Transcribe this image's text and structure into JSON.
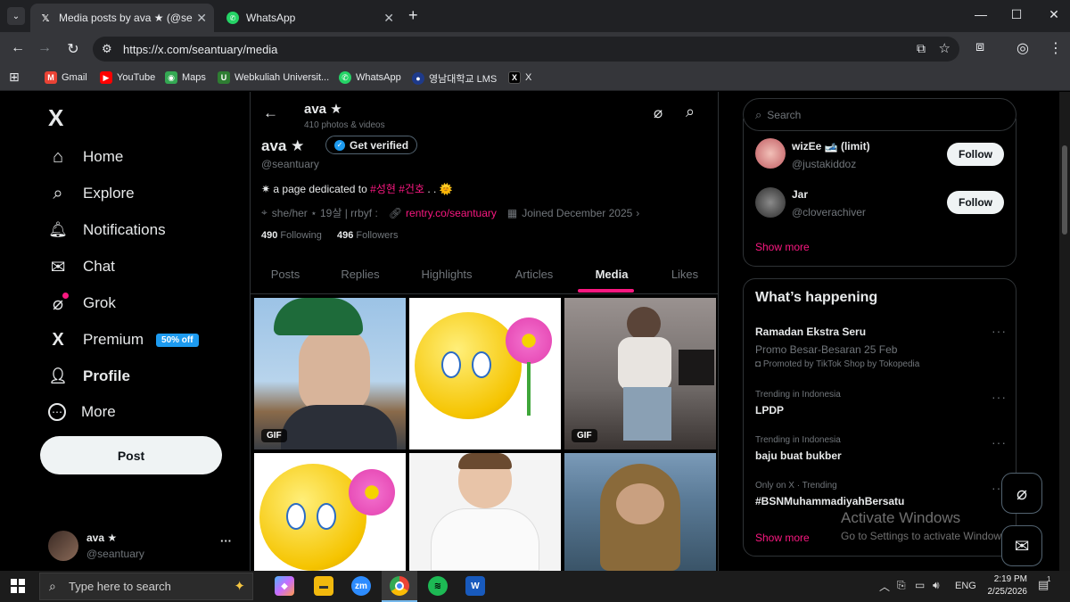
{
  "browser": {
    "tabs": [
      {
        "title": "Media posts by ava ★ (@seantu",
        "icon": "x-logo-icon"
      },
      {
        "title": "WhatsApp",
        "icon": "whatsapp-icon"
      }
    ],
    "new_tab": "+",
    "url": "https://x.com/seantuary/media",
    "bookmarks": [
      {
        "label": "Gmail",
        "color": "#ea4335",
        "glyph": "M"
      },
      {
        "label": "YouTube",
        "color": "#ff0000",
        "glyph": "▶"
      },
      {
        "label": "Maps",
        "color": "#34a853",
        "glyph": "◉"
      },
      {
        "label": "Webkuliah Universit...",
        "color": "#2e7d32",
        "glyph": "U"
      },
      {
        "label": "WhatsApp",
        "color": "#25d366",
        "glyph": "✆"
      },
      {
        "label": "영남대학교 LMS",
        "color": "#1e3a8a",
        "glyph": "●"
      },
      {
        "label": "X",
        "color": "#000000",
        "glyph": "X"
      }
    ]
  },
  "sidebar": {
    "logo": "X",
    "items": [
      {
        "label": "Home",
        "icon": "home-icon",
        "glyph": "⌂"
      },
      {
        "label": "Explore",
        "icon": "search-icon",
        "glyph": "⌕"
      },
      {
        "label": "Notifications",
        "icon": "bell-icon",
        "glyph": "🔔"
      },
      {
        "label": "Chat",
        "icon": "mail-icon",
        "glyph": "✉"
      },
      {
        "label": "Grok",
        "icon": "grok-icon",
        "glyph": "⌀"
      },
      {
        "label": "Premium",
        "icon": "x-logo-icon",
        "glyph": "X",
        "badge": "50% off"
      },
      {
        "label": "Profile",
        "icon": "person-icon",
        "glyph": "👤"
      },
      {
        "label": "More",
        "icon": "more-circle-icon",
        "glyph": "⋯"
      }
    ],
    "post_label": "Post",
    "account": {
      "name": "ava ★",
      "handle": "@seantuary",
      "more": "···"
    }
  },
  "profile": {
    "header_name": "ava ★",
    "header_count": "410 photos & videos",
    "name": "ava ★",
    "verify_label": "Get verified",
    "handle": "@seantuary",
    "bio_prefix": "✷ a page dedicated to ",
    "bio_tags": "#성현 #건호",
    "bio_suffix": " . . 🌞",
    "location": "she/her ⋆ 19살 | rrbyf :",
    "link": "rentry.co/seantuary",
    "joined": "Joined December 2025",
    "following_count": "490",
    "following_label": "Following",
    "followers_count": "496",
    "followers_label": "Followers",
    "tabs": [
      "Posts",
      "Replies",
      "Highlights",
      "Articles",
      "Media",
      "Likes"
    ],
    "active_tab": "Media",
    "gif_label": "GIF"
  },
  "right": {
    "search_placeholder": "Search",
    "who_to_follow": [
      {
        "name": "wizEe 🎿 (limit)",
        "handle": "@justakiddoz",
        "button": "Follow"
      },
      {
        "name": "Jar",
        "handle": "@cloverachiver",
        "button": "Follow"
      }
    ],
    "show_more": "Show more",
    "happening_title": "What’s happening",
    "trends": [
      {
        "context": "",
        "name": "Ramadan Ekstra Seru",
        "sub": "Promo Besar-Besaran 25 Feb",
        "promoted": "Promoted by TikTok Shop by Tokopedia"
      },
      {
        "context": "Trending in Indonesia",
        "name": "LPDP",
        "sub": "",
        "promoted": ""
      },
      {
        "context": "Trending in Indonesia",
        "name": "baju buat bukber",
        "sub": "",
        "promoted": ""
      },
      {
        "context": "Only on X · Trending",
        "name": "#BSNMuhammadiyahBersatu",
        "sub": "",
        "promoted": ""
      }
    ],
    "show_more_2": "Show more"
  },
  "watermark": {
    "title": "Activate Windows",
    "sub": "Go to Settings to activate Windows."
  },
  "taskbar": {
    "search_placeholder": "Type here to search",
    "lang": "ENG",
    "time": "2:19 PM",
    "date": "2/25/2026",
    "notification_count": "1"
  },
  "colors": {
    "accent": "#f91880",
    "verify_blue": "#1d9bf0",
    "premium_badge": "#1d9bf0"
  }
}
